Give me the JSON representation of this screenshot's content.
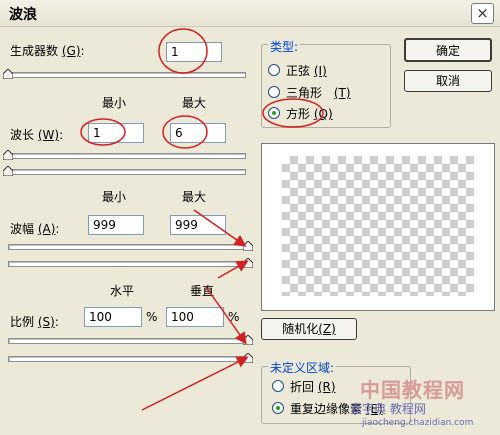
{
  "dialog": {
    "title": "波浪",
    "close_glyph": "×"
  },
  "generators": {
    "label": "生成器数",
    "shortcut": "(G)",
    "value": "1",
    "slider_level": 0.0
  },
  "min_label": "最小",
  "max_label": "最大",
  "wavelength": {
    "label": "波长",
    "shortcut": "(W)",
    "min": "1",
    "max": "6",
    "min_level": 0.0,
    "max_level": 0.0
  },
  "amplitude": {
    "label": "波幅",
    "shortcut": "(A)",
    "min": "999",
    "max": "999",
    "min_level": 1.0,
    "max_level": 1.0
  },
  "scale": {
    "label": "比例",
    "shortcut": "(S)",
    "horizontal_label": "水平",
    "vertical_label": "垂直",
    "horizontal": "100",
    "vertical": "100",
    "percent": "%",
    "horizontal_level": 1.0,
    "vertical_level": 1.0
  },
  "type_group": {
    "title": "类型:",
    "options": [
      {
        "label": "正弦",
        "shortcut": "(I)",
        "selected": false
      },
      {
        "label": "三角形",
        "shortcut": "(T)",
        "selected": false
      },
      {
        "label": "方形",
        "shortcut": "(Q)",
        "selected": true
      }
    ]
  },
  "buttons": {
    "ok": "确定",
    "cancel": "取消",
    "randomize": "随机化",
    "randomize_shortcut": "(Z)"
  },
  "undefined_group": {
    "title": "未定义区域:",
    "options": [
      {
        "label": "折回",
        "shortcut": "(R)",
        "selected": false
      },
      {
        "label": "重复边缘像素",
        "shortcut": "(E)",
        "selected": true
      }
    ]
  },
  "watermark": {
    "line1": "中国教程网",
    "line2": "查字典 教程网",
    "line3": "jiaocheng.chazidian.com"
  },
  "annotation_color": "#d42020"
}
